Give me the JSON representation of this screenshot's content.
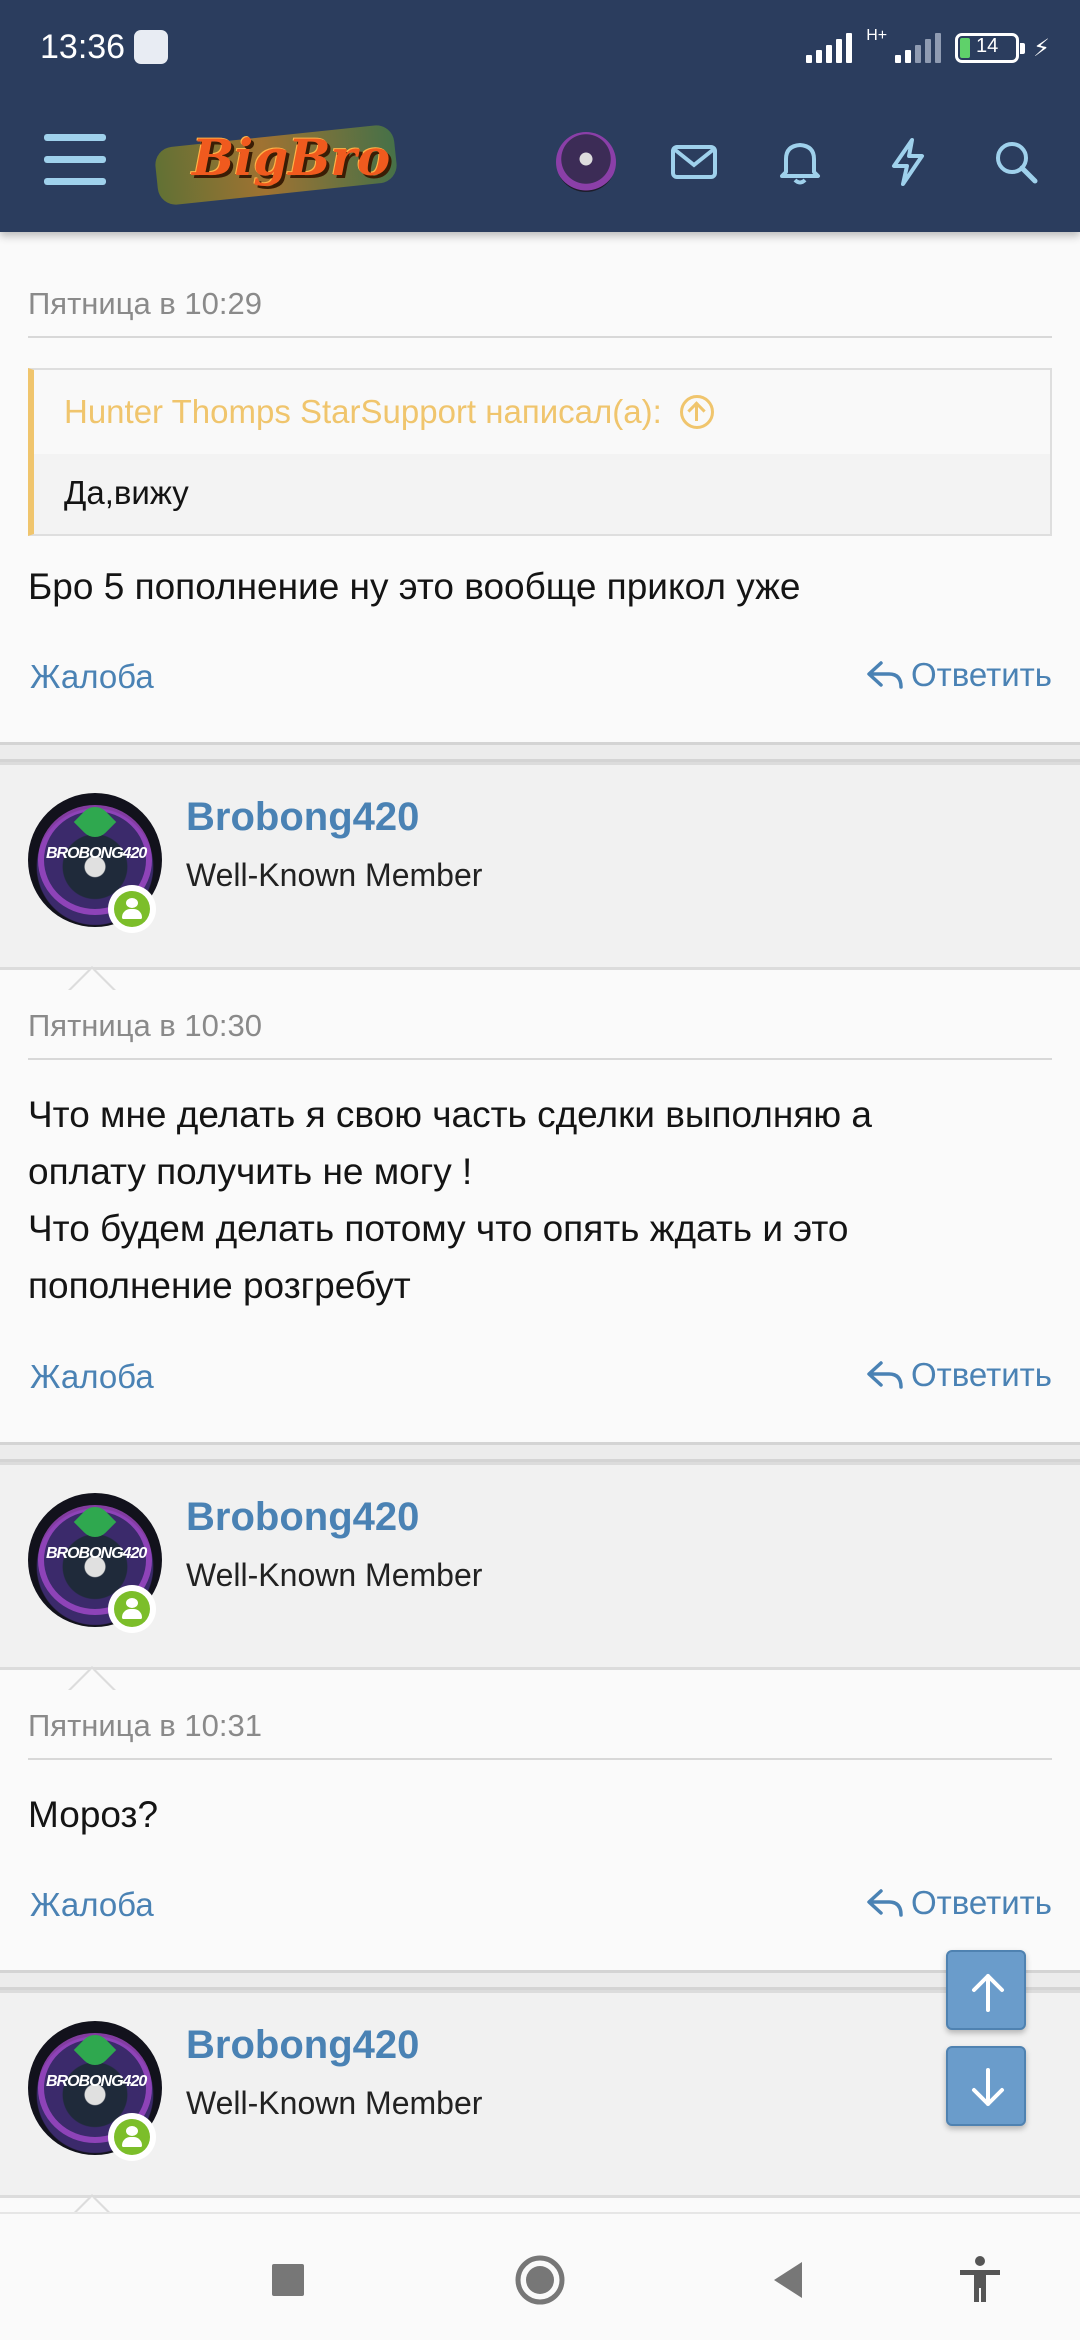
{
  "status_bar": {
    "time": "13:36",
    "network": "H+",
    "battery": "14"
  },
  "header": {
    "logo_text": "BigBro"
  },
  "posts": [
    {
      "date": "Пятница в 10:29",
      "quote": {
        "author": "Hunter Thomps StarSupport написал(а):",
        "text": "Да,вижу"
      },
      "message": "Бро 5 пополнение ну это вообще прикол уже",
      "report_label": "Жалоба",
      "reply_label": "Ответить"
    },
    {
      "author": {
        "name": "Brobong420",
        "title": "Well-Known Member",
        "avatar_tag": "BROBONG420"
      },
      "date": "Пятница в 10:30",
      "message_lines": [
        "Что мне делать я свою часть сделки выполняю а",
        "оплату получить не могу !",
        "Что будем делать потому что опять ждать и это",
        "пополнение розгребут"
      ],
      "report_label": "Жалоба",
      "reply_label": "Ответить"
    },
    {
      "author": {
        "name": "Brobong420",
        "title": "Well-Known Member",
        "avatar_tag": "BROBONG420"
      },
      "date": "Пятница в 10:31",
      "message": "Мороз?",
      "report_label": "Жалоба",
      "reply_label": "Ответить"
    },
    {
      "author": {
        "name": "Brobong420",
        "title": "Well-Known Member",
        "avatar_tag": "BROBONG420"
      }
    }
  ],
  "icons": {
    "menu": "hamburger-icon",
    "mail": "envelope-icon",
    "alerts": "bell-icon",
    "whats_new": "bolt-icon",
    "search": "search-icon",
    "reply": "reply-arrow-icon",
    "scroll_up": "arrow-up-icon",
    "scroll_down": "arrow-down-icon"
  },
  "colors": {
    "header_bg": "#2b3d5e",
    "link": "#4a82b4",
    "quote_accent": "#f0c56d",
    "online": "#7cbe2a"
  }
}
